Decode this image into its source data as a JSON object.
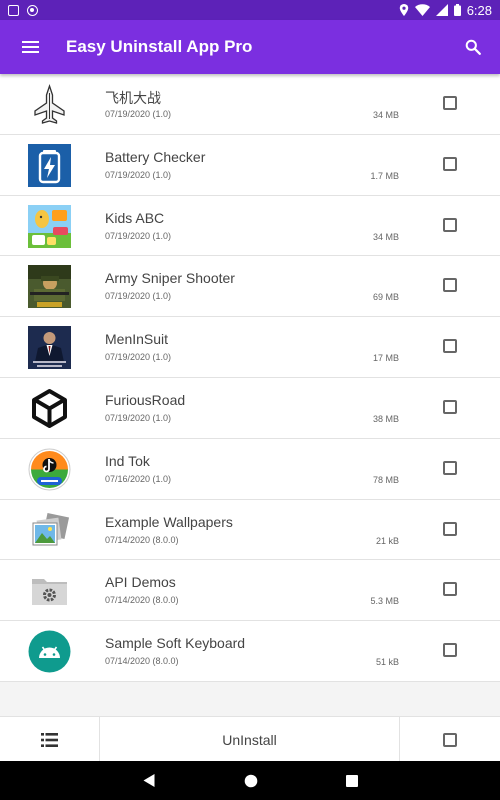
{
  "status_bar": {
    "time": "6:28"
  },
  "app_bar": {
    "title": "Easy Uninstall App Pro",
    "menu_icon": "hamburger-icon",
    "search_icon": "search-icon"
  },
  "apps": [
    {
      "name": "飞机大战",
      "meta": "07/19/2020 (1.0)",
      "size": "34 MB",
      "icon": "jet-icon"
    },
    {
      "name": "Battery Checker",
      "meta": "07/19/2020 (1.0)",
      "size": "1.7 MB",
      "icon": "battery-icon"
    },
    {
      "name": "Kids ABC",
      "meta": "07/19/2020 (1.0)",
      "size": "34 MB",
      "icon": "kids-abc-icon"
    },
    {
      "name": "Army Sniper Shooter",
      "meta": "07/19/2020 (1.0)",
      "size": "69 MB",
      "icon": "sniper-icon"
    },
    {
      "name": "MenInSuit",
      "meta": "07/19/2020 (1.0)",
      "size": "17 MB",
      "icon": "suit-icon"
    },
    {
      "name": "FuriousRoad",
      "meta": "07/19/2020 (1.0)",
      "size": "38 MB",
      "icon": "unity-icon"
    },
    {
      "name": "Ind Tok",
      "meta": "07/16/2020 (1.0)",
      "size": "78 MB",
      "icon": "indtok-icon"
    },
    {
      "name": "Example Wallpapers",
      "meta": "07/14/2020 (8.0.0)",
      "size": "21 kB",
      "icon": "wallpapers-icon"
    },
    {
      "name": "API Demos",
      "meta": "07/14/2020 (8.0.0)",
      "size": "5.3 MB",
      "icon": "folder-gear-icon"
    },
    {
      "name": "Sample Soft Keyboard",
      "meta": "07/14/2020 (8.0.0)",
      "size": "51 kB",
      "icon": "android-icon"
    }
  ],
  "bottom_bar": {
    "uninstall_label": "UnInstall",
    "list_icon": "list-icon"
  },
  "colors": {
    "status_bar": "#5d22b8",
    "app_bar": "#7b2fe0"
  }
}
